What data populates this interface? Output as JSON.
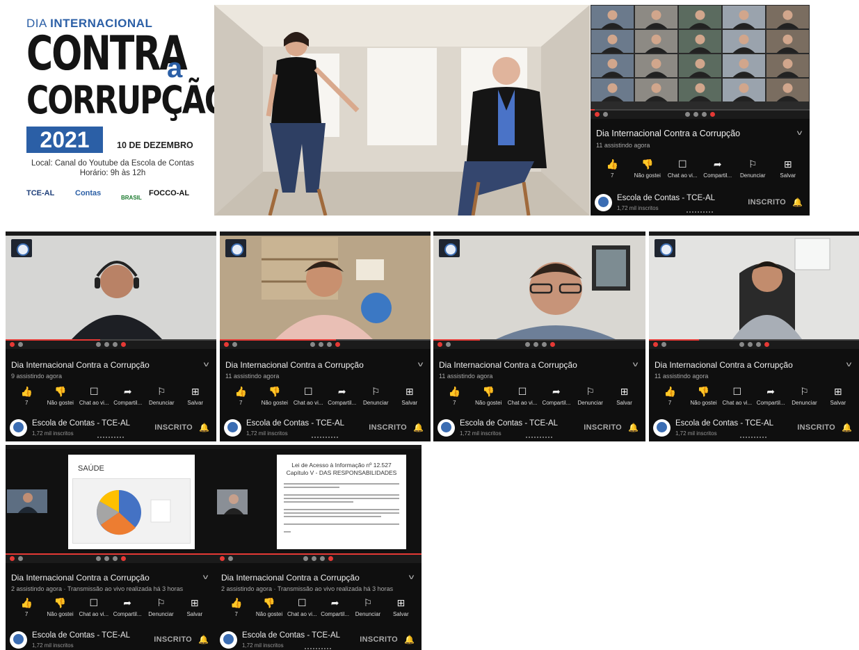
{
  "poster": {
    "line_prefix": "DIA ",
    "line_bold": "INTERNACIONAL",
    "contra": "CONTRA",
    "a": "a",
    "corrupcao": "CORRUPÇÃO",
    "year": "2021",
    "date": "10 DE DEZEMBRO",
    "local": "Local: Canal do Youtube da Escola de Contas",
    "horario": "Horário: 9h às 12h",
    "logos": [
      "TCE-AL",
      "Contas",
      "BRASIL",
      "FOCCO-AL"
    ],
    "colors": {
      "blue": "#2b5fa6",
      "black": "#141414"
    }
  },
  "common": {
    "title": "Dia Internacional Contra a Corrupção",
    "channel": "Escola de Contas - TCE-AL",
    "subs": "1,72 mil inscritos",
    "subscribe": "INSCRITO",
    "actions": [
      {
        "icon": "thumbs-up-icon",
        "glyph": "👍",
        "label": "7"
      },
      {
        "icon": "thumbs-down-icon",
        "glyph": "👎",
        "label": "Não gostei"
      },
      {
        "icon": "chat-icon",
        "glyph": "☐",
        "label": "Chat ao vi..."
      },
      {
        "icon": "share-icon",
        "glyph": "➦",
        "label": "Compartil..."
      },
      {
        "icon": "flag-icon",
        "glyph": "⚐",
        "label": "Denunciar"
      },
      {
        "icon": "save-icon",
        "glyph": "⊞",
        "label": "Salvar"
      }
    ]
  },
  "panels": [
    {
      "watching": "11 assistindo agora"
    },
    {
      "watching": "9 assistindo agora"
    },
    {
      "watching": "11 assistindo agora"
    },
    {
      "watching": "11 assistindo agora"
    },
    {
      "watching": "11 assistindo agora"
    },
    {
      "watching": "2 assistindo agora · Transmissão ao vivo realizada há 3 horas",
      "slide_title": "SAÚDE"
    },
    {
      "watching": "2 assistindo agora · Transmissão ao vivo realizada há 3 horas",
      "slide_title": "Lei de Acesso à Informação nº 12.527",
      "slide_subtitle": "Capítulo V - DAS RESPONSABILIDADES"
    }
  ]
}
